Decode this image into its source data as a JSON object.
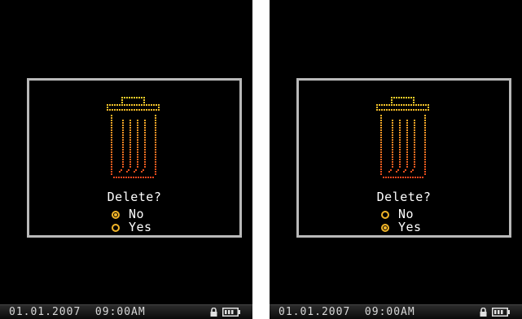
{
  "screens": [
    {
      "dialog": {
        "icon": "trash-can-icon",
        "prompt": "Delete?",
        "options": [
          {
            "label": "No",
            "selected": true
          },
          {
            "label": "Yes",
            "selected": false
          }
        ]
      },
      "status_bar": {
        "datetime": "01.01.2007  09:00AM",
        "lock_icon": "lock-icon",
        "battery_icon": "battery-icon"
      }
    },
    {
      "dialog": {
        "icon": "trash-can-icon",
        "prompt": "Delete?",
        "options": [
          {
            "label": "No",
            "selected": false
          },
          {
            "label": "Yes",
            "selected": true
          }
        ]
      },
      "status_bar": {
        "datetime": "01.01.2007  09:00AM",
        "lock_icon": "lock-icon",
        "battery_icon": "battery-icon"
      }
    }
  ],
  "colors": {
    "accent": "#f0b428",
    "trash_top": "#f5d42a",
    "trash_bottom": "#e8401c",
    "dialog_border": "#b9b9b9",
    "text": "#ffffff",
    "background": "#000000"
  }
}
